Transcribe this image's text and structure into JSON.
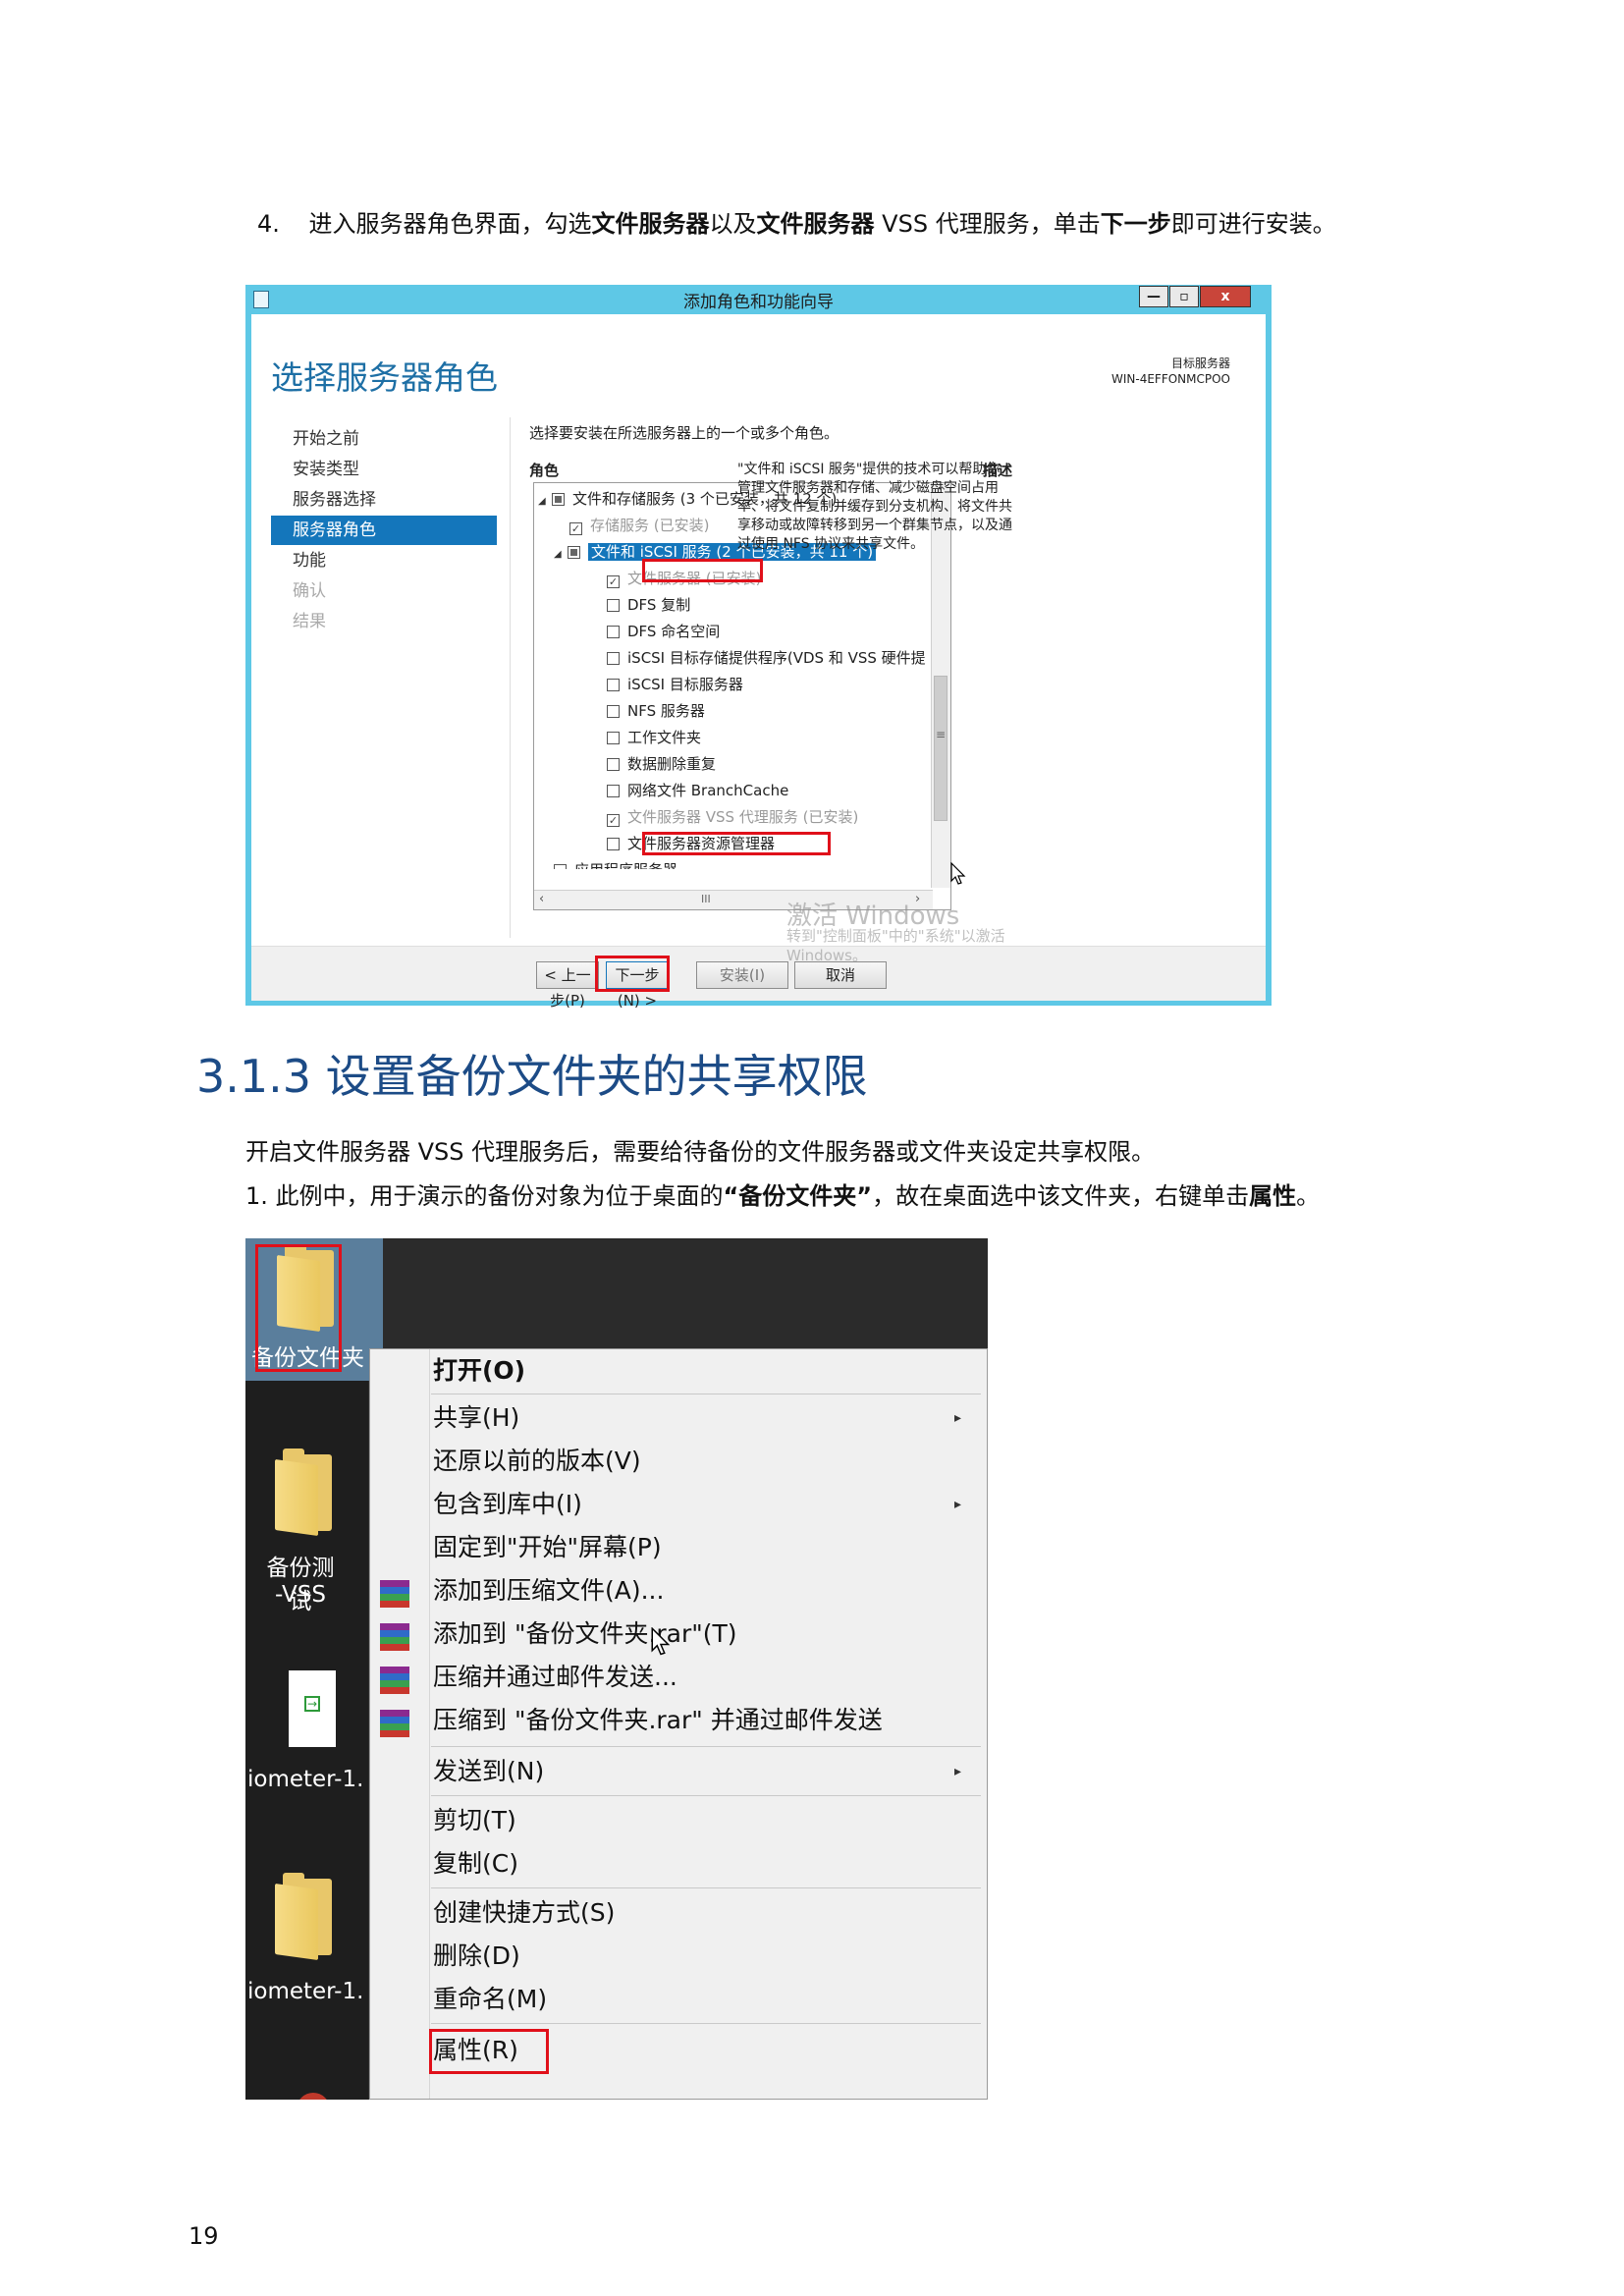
{
  "step4": {
    "num": "4.",
    "t1": "进入服务器角色界面，勾选",
    "b1": "文件服务器",
    "t2": "以及",
    "b2": "文件服务器",
    "t3": " VSS 代理服务，单击",
    "b3": "下一步",
    "t4": "即可进行安装。"
  },
  "dialog": {
    "window_title": "添加角色和功能向导",
    "window_buttons": [
      "—",
      "▫",
      "x"
    ],
    "heading": "选择服务器角色",
    "target_label": "目标服务器",
    "target_server": "WIN-4EFFONMCPOO",
    "nav": [
      "开始之前",
      "安装类型",
      "服务器选择",
      "服务器角色",
      "功能",
      "确认",
      "结果"
    ],
    "instruction": "选择要安装在所选服务器上的一个或多个角色。",
    "roles_header": "角色",
    "desc_header": "描述",
    "tree": [
      "文件和存储服务 (3 个已安装，共 12 个)",
      "存储服务 (已安装)",
      "文件和 iSCSI 服务 (2 个已安装，共 11 个)",
      "文件服务器 (已安装)",
      "DFS 复制",
      "DFS 命名空间",
      "iSCSI 目标存储提供程序(VDS 和 VSS 硬件提",
      "iSCSI 目标服务器",
      "NFS 服务器",
      "工作文件夹",
      "数据删除重复",
      "网络文件 BranchCache",
      "文件服务器 VSS 代理服务 (已安装)",
      "文件服务器资源管理器",
      "应用程序服务器"
    ],
    "description": "\"文件和 iSCSI 服务\"提供的技术可以帮助你管理文件服务器和存储、减少磁盘空间占用率、将文件复制并缓存到分支机构、将文件共享移动或故障转移到另一个群集节点，以及通过使用 NFS 协议来共享文件。",
    "scroll_mark": "≡",
    "scroll_h": "III",
    "buttons": {
      "prev": "< 上一步(P)",
      "next": "下一步(N) >",
      "install": "安装(I)",
      "cancel": "取消"
    },
    "watermark1": "激活 Windows",
    "watermark2": "转到\"控制面板\"中的\"系统\"以激活",
    "watermark3": "Windows。"
  },
  "section": {
    "title": "3.1.3 设置备份文件夹的共享权限"
  },
  "para1": "开启文件服务器 VSS 代理服务后，需要给待备份的文件服务器或文件夹设定共享权限。",
  "step1": {
    "t1": "1. 此例中，用于演示的备份对象为位于桌面的",
    "b1": "“备份文件夹”",
    "t2": "，故在桌面选中该文件夹，右键单击",
    "b2": "属性",
    "t3": "。"
  },
  "desktop": {
    "icons": [
      "备份文件夹",
      "备份测试",
      "-VSS",
      "iometer-1.",
      "iometer-1."
    ],
    "menu": [
      {
        "label": "打开(O)",
        "bold": true
      },
      {
        "label": "共享(H)",
        "sub": true
      },
      {
        "label": "还原以前的版本(V)"
      },
      {
        "label": "包含到库中(I)",
        "sub": true
      },
      {
        "label": "固定到\"开始\"屏幕(P)"
      },
      {
        "label": "添加到压缩文件(A)...",
        "icon": "winrar-icon"
      },
      {
        "label": "添加到 \"备份文件夹.rar\"(T)",
        "icon": "winrar-icon"
      },
      {
        "label": "压缩并通过邮件发送...",
        "icon": "winrar-icon"
      },
      {
        "label": "压缩到 \"备份文件夹.rar\" 并通过邮件发送",
        "icon": "winrar-icon"
      },
      {
        "label": "发送到(N)",
        "sub": true
      },
      {
        "label": "剪切(T)"
      },
      {
        "label": "复制(C)"
      },
      {
        "label": "创建快捷方式(S)"
      },
      {
        "label": "删除(D)"
      },
      {
        "label": "重命名(M)"
      },
      {
        "label": "属性(R)"
      }
    ],
    "submenu_arrow": "▸"
  },
  "page_number": "19"
}
